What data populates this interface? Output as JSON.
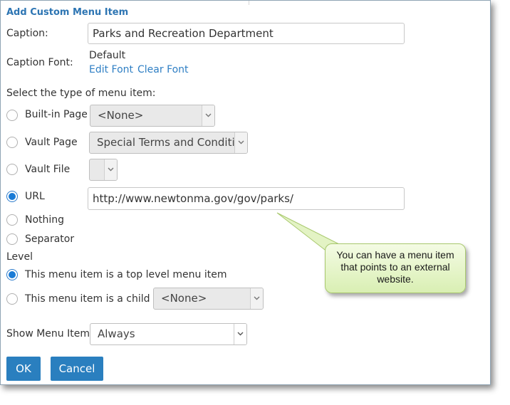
{
  "dialog": {
    "title": "Add Custom Menu Item",
    "caption_label": "Caption:",
    "caption_value": "Parks and Recreation Department",
    "caption_font_label": "Caption Font:",
    "caption_font_value": "Default",
    "edit_font": "Edit Font",
    "clear_font": "Clear Font",
    "type_label": "Select the type of menu item:",
    "types": [
      {
        "label": "Built-in Page",
        "selected": false,
        "select_value": "<None>"
      },
      {
        "label": "Vault Page",
        "selected": false,
        "select_value": "Special Terms and Conditic"
      },
      {
        "label": "Vault File",
        "selected": false,
        "select_value": ""
      },
      {
        "label": "URL",
        "selected": true,
        "input_value": "http://www.newtonma.gov/gov/parks/"
      },
      {
        "label": "Nothing",
        "selected": false
      },
      {
        "label": "Separator",
        "selected": false
      }
    ],
    "level_label": "Level",
    "level_top": "This menu item is a top level menu item",
    "level_child": "This menu item is a child of",
    "level_child_select": "<None>",
    "show_label": "Show Menu Item:",
    "show_value": "Always",
    "ok": "OK",
    "cancel": "Cancel"
  },
  "callout": {
    "text": "You can have a menu item that points to an external website."
  },
  "colors": {
    "title": "#2d75b3",
    "link": "#2f7fc4",
    "button": "#2a7fbf",
    "radio_selected": "#1a7bd6",
    "callout_top": "#f4fbe4",
    "callout_bottom": "#d9efb3"
  }
}
